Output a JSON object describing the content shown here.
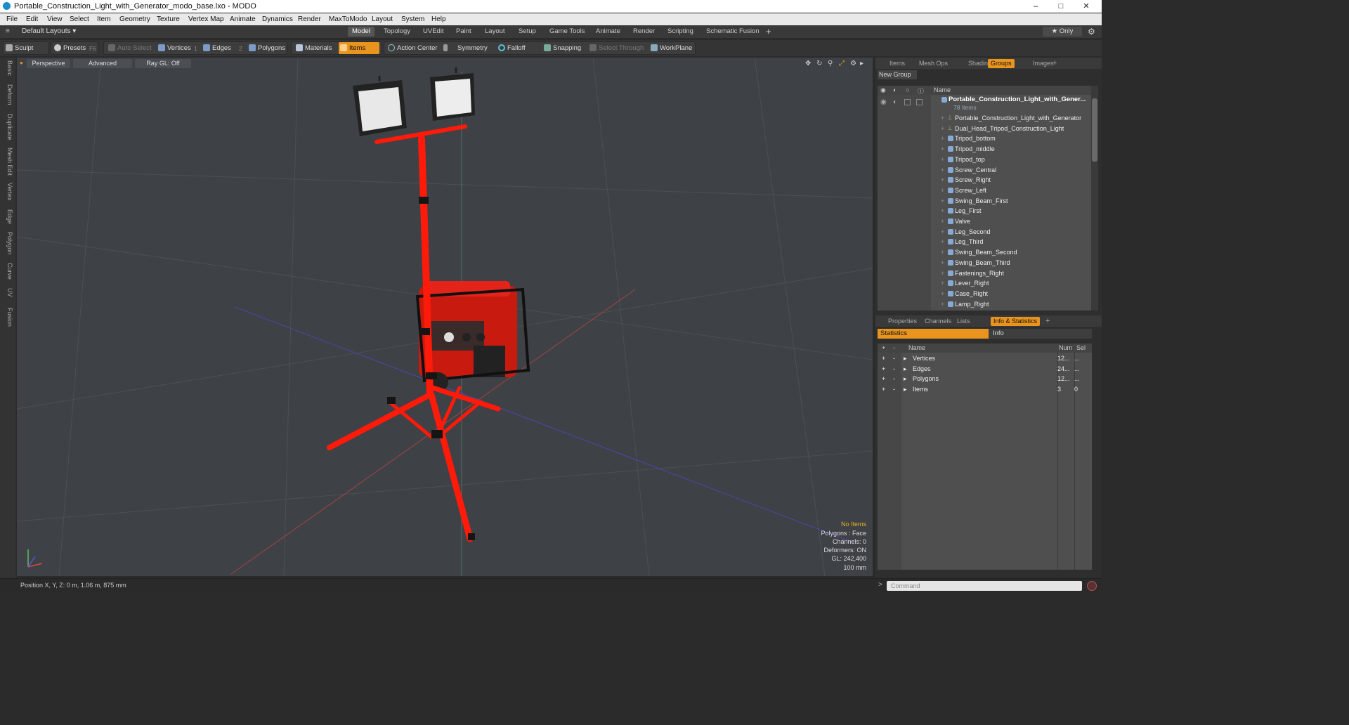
{
  "window": {
    "title": "Portable_Construction_Light_with_Generator_modo_base.lxo - MODO",
    "icons": [
      "modo-app-icon",
      "minimize-icon",
      "maximize-icon",
      "close-icon"
    ]
  },
  "menu": [
    "File",
    "Edit",
    "View",
    "Select",
    "Item",
    "Geometry",
    "Texture",
    "Vertex Map",
    "Animate",
    "Dynamics",
    "Render",
    "MaxToModo",
    "Layout",
    "System",
    "Help"
  ],
  "layoutbar": {
    "layouts": "Default Layouts ▾",
    "tabs": [
      "Model",
      "Topology",
      "UVEdit",
      "Paint",
      "Layout",
      "Setup",
      "Game Tools",
      "Animate",
      "Render",
      "Scripting",
      "Schematic Fusion"
    ],
    "active_tab": "Model",
    "add": "+",
    "only": "★  Only"
  },
  "toolbar": {
    "sculpt": "Sculpt",
    "presets": "Presets",
    "presets_key": "F6",
    "auto_select": "Auto Select",
    "vertices": "Vertices",
    "vertices_num": "1",
    "edges": "Edges",
    "edges_num": "2",
    "polygons": "Polygons",
    "materials": "Materials",
    "items": "Items",
    "action_center": "Action Center",
    "symmetry": "Symmetry",
    "falloff": "Falloff",
    "snapping": "Snapping",
    "select_through": "Select Through",
    "workplane": "WorkPlane"
  },
  "sidebar": [
    "Basic",
    "Deform",
    "Duplicate",
    "Mesh Edit",
    "Vertex",
    "Edge",
    "Polygon",
    "Curve",
    "UV",
    "Fusion"
  ],
  "viewport": {
    "view": "Perspective",
    "shading": "Advanced",
    "raygl": "Ray GL: Off",
    "hud": {
      "selection": "No Items",
      "polygons": "Polygons : Face",
      "channels": "Channels: 0",
      "deformers": "Deformers: ON",
      "gl": "GL: 242,400",
      "scale": "100 mm"
    }
  },
  "panel_top": {
    "tabs": [
      "Items",
      "Mesh Ops",
      "Shading",
      "Groups",
      "Images"
    ],
    "active": "Groups",
    "add": "+",
    "new_group": "New Group",
    "name_header": "Name",
    "group_name": "Portable_Construction_Light_with_Gener...",
    "group_count": "78 Items",
    "items": [
      "Portable_Construction_Light_with_Generator",
      "Dual_Head_Tripod_Construction_Light",
      "Tripod_bottom",
      "Tripod_middle",
      "Tripod_top",
      "Screw_Central",
      "Screw_Right",
      "Screw_Left",
      "Swing_Beam_First",
      "Leg_First",
      "Valve",
      "Leg_Second",
      "Leg_Third",
      "Swing_Beam_Second",
      "Swing_Beam_Third",
      "Fastenings_Right",
      "Lever_Right",
      "Case_Right",
      "Lamp_Right"
    ]
  },
  "panel_bottom": {
    "tabs": [
      "Properties",
      "Channels",
      "Lists",
      "Info & Statistics"
    ],
    "active": "Info & Statistics",
    "add": "+",
    "subtabs": [
      "Statistics",
      "Info"
    ],
    "headers": {
      "name": "Name",
      "num": "Num",
      "sel": "Sel"
    },
    "rows": [
      {
        "name": "Vertices",
        "num": "12...",
        "sel": "..."
      },
      {
        "name": "Edges",
        "num": "24...",
        "sel": "..."
      },
      {
        "name": "Polygons",
        "num": "12...",
        "sel": "..."
      },
      {
        "name": "Items",
        "num": "3",
        "sel": "0"
      }
    ]
  },
  "statusbar": {
    "position": "Position X, Y, Z:   0 m, 1.06 m, 875 mm",
    "command_placeholder": "Command",
    "prompt": ">"
  },
  "colors": {
    "accent": "#e8941e",
    "hud_highlight": "#e8b31b",
    "viewport_bg": "#3e4145",
    "model_red": "#ff1a0a"
  }
}
